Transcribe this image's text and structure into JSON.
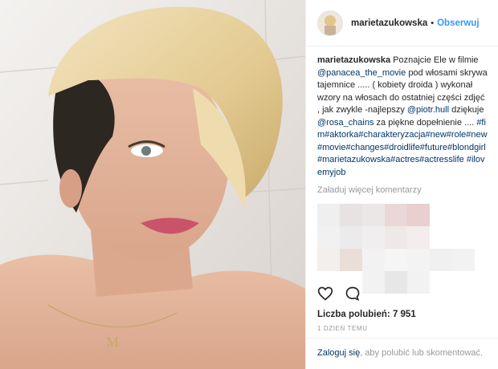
{
  "header": {
    "username": "marietazukowska",
    "separator": "•",
    "follow_label": "Obserwuj"
  },
  "caption": {
    "username": "marietazukowska",
    "t1": "Poznajcie Ele w filmie",
    "mention1": "@panacea_the_movie",
    "t2": "pod włosami skrywa tajemnice ..... ( kobiety droida ) wykonał wzory na włosach do ostatniej części zdjęć , jak zwykle -najlepszy",
    "mention2": "@piotr.hull",
    "t3": "dziękuje",
    "mention3": "@rosa_chains",
    "t4": "za piękne dopełnienie ....",
    "hashtags": "#fim#aktorka#charakteryzacja#new#role#new#movie#changes#droidlife#future#blondgirl#marietazukowska#actres#actresslife #ilovemyjob"
  },
  "load_more": "Załaduj więcej komentarzy",
  "icons": {
    "like": "heart-icon",
    "comment": "comment-icon"
  },
  "likes": {
    "label": "Liczba polubień:",
    "count": "7 951"
  },
  "time_ago": "1 DZIEŃ TEMU",
  "footer": {
    "login_link": "Zaloguj się",
    "text": ", aby polubić lub skomentować."
  },
  "colors": {
    "link": "#003569",
    "follow": "#3897f0",
    "muted": "#999999"
  }
}
